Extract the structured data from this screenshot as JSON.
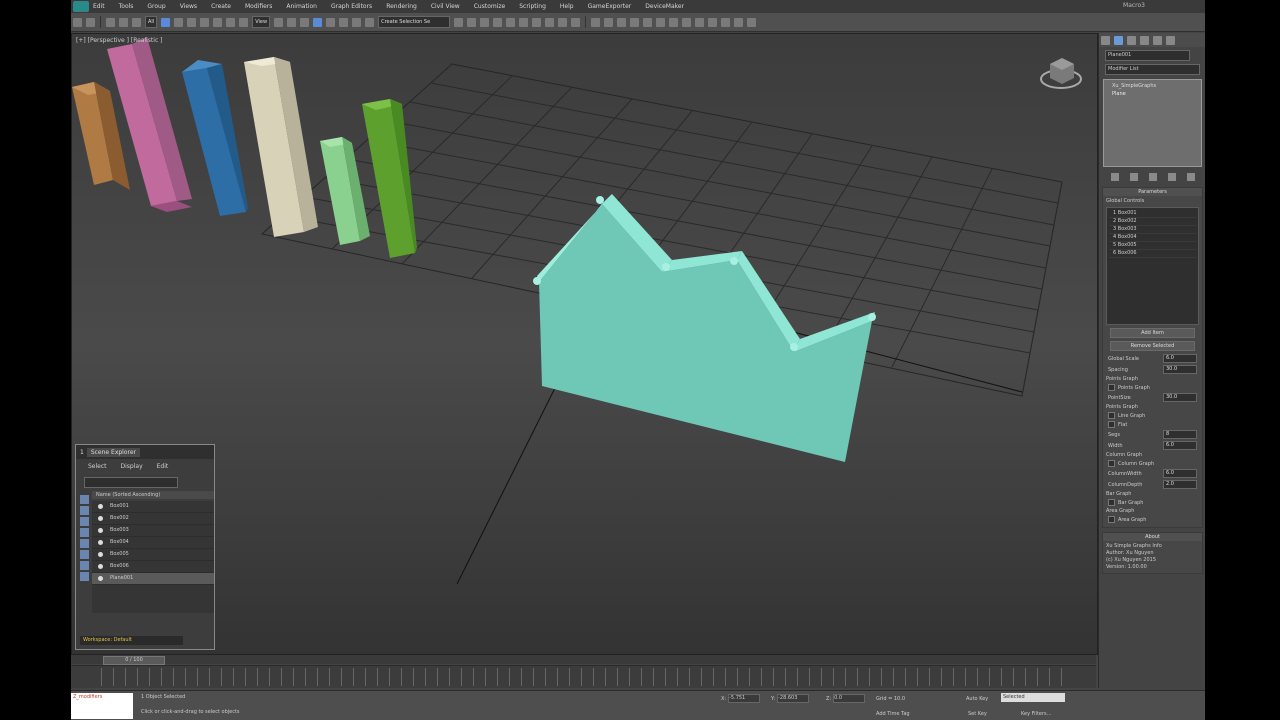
{
  "menus": [
    "Edit",
    "Tools",
    "Group",
    "Views",
    "Create",
    "Modifiers",
    "Animation",
    "Graph Editors",
    "Rendering",
    "Civil View",
    "Customize",
    "Scripting",
    "Help",
    "GameExporter",
    "DeviceMaker"
  ],
  "window_title": "Macro3",
  "toolbar": {
    "selection_filter": "All",
    "ref_coord": "View",
    "named_sel": "Create Selection Se"
  },
  "viewport": {
    "label": "[+] [Perspective ] [Realistic ]"
  },
  "command_panel": {
    "object_name": "Plane001",
    "modifier_list": "Modifier List",
    "stack": [
      "Xu_SimpleGraphs",
      "Plane"
    ],
    "rollout_title": "Parameters",
    "global_controls": "Global Controls",
    "items": [
      "1 Box001",
      "2 Box002",
      "3 Box003",
      "4 Box004",
      "5 Box005",
      "6 Box006"
    ],
    "add_item": "Add Item",
    "remove_selected": "Remove Selected",
    "global_scale_label": "Global Scale",
    "global_scale_value": "6.0",
    "spacing_label": "Spacing",
    "spacing_value": "30.0",
    "points_graph_group": "Points Graph",
    "points_graph_chk": "Points Graph",
    "pointsize_label": "PointSize",
    "pointsize_value": "30.0",
    "line_group": "Points Graph",
    "line_graph_chk": "Line Graph",
    "flat_chk": "Flat",
    "segs_label": "Segs",
    "segs_value": "8",
    "width_label": "Width",
    "width_value": "6.0",
    "column_group": "Column Graph",
    "column_chk": "Column Graph",
    "colwidth_label": "ColumnWidth",
    "colwidth_value": "6.0",
    "coldepth_label": "ColumnDepth",
    "coldepth_value": "2.0",
    "bar_group": "Bar Graph",
    "bar_chk": "Bar Graph",
    "area_group": "Area Graph",
    "area_chk": "Area Graph",
    "about_title": "About",
    "about_lines": [
      "Xu Simple Graphs Info",
      "Author: Xu Nguyen",
      "(c) Xu Nguyen 2015",
      "Version: 1.00.00"
    ]
  },
  "scene_explorer": {
    "title": "Scene Explorer",
    "tab_label": "1",
    "menu": [
      "Select",
      "Display",
      "Edit"
    ],
    "column_header": "Name (Sorted Ascending)",
    "rows": [
      "Box001",
      "Box002",
      "Box003",
      "Box004",
      "Box005",
      "Box006",
      "Plane001"
    ],
    "selected_index": 6,
    "workspace": "Workspace: Default"
  },
  "timeline": {
    "frame_label": "0 / 100"
  },
  "status": {
    "maxscript": "Z_modifiers",
    "selected": "1 Object Selected",
    "prompt": "Click or click-and-drag to select objects",
    "x_label": "X:",
    "x_value": "-5.751",
    "y_label": "Y:",
    "y_value": "-28.603",
    "z_label": "Z:",
    "z_value": "0.0",
    "grid": "Grid = 10.0",
    "add_time_tag": "Add Time Tag",
    "autokey": "Auto Key",
    "autokey_value": "Selected",
    "setkey": "Set Key",
    "keyfilters": "Key Filters..."
  },
  "colors": {
    "area_graph": "#7ee2cf",
    "bars": [
      "#b07a44",
      "#c06a9e",
      "#2e6ea6",
      "#d8d2b8",
      "#8ad08e",
      "#5da02e"
    ]
  }
}
